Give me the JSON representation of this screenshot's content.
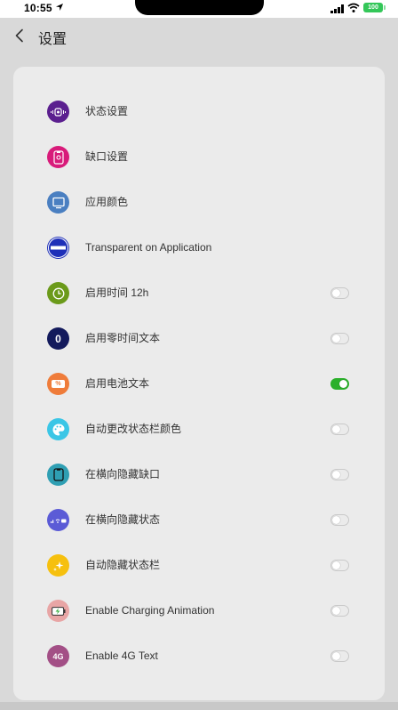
{
  "status_bar": {
    "time": "10:55",
    "battery": "100"
  },
  "header": {
    "title": "设置"
  },
  "colors": {
    "accent_on": "#2bb02b",
    "card_bg": "#ebebeb",
    "page_bg": "#d9d9d9"
  },
  "settings": [
    {
      "label": "状态设置",
      "icon": "status-settings-icon",
      "icon_color": "#5b1f8f",
      "toggle": null
    },
    {
      "label": "缺口设置",
      "icon": "notch-settings-icon",
      "icon_color": "#d81b7a",
      "toggle": null
    },
    {
      "label": "应用颜色",
      "icon": "app-color-icon",
      "icon_color": "#4a7fc1",
      "toggle": null
    },
    {
      "label": "Transparent on Application",
      "icon": "transparent-icon",
      "icon_color": "#1e2fb8",
      "toggle": null
    },
    {
      "label": "启用时间 12h",
      "icon": "clock-icon",
      "icon_color": "#6b9a1a",
      "toggle": false
    },
    {
      "label": "启用零时间文本",
      "icon": "zero-icon",
      "icon_color": "#131a5c",
      "toggle": false
    },
    {
      "label": "启用电池文本",
      "icon": "battery-percent-icon",
      "icon_color": "#ef7c3a",
      "toggle": true
    },
    {
      "label": "自动更改状态栏颜色",
      "icon": "palette-icon",
      "icon_color": "#3bc6e6",
      "toggle": false
    },
    {
      "label": "在横向隐藏缺口",
      "icon": "phone-notch-icon",
      "icon_color": "#2f9fb3",
      "toggle": false
    },
    {
      "label": "在横向隐藏状态",
      "icon": "status-bar-icon",
      "icon_color": "#5b5bd6",
      "toggle": false
    },
    {
      "label": "自动隐藏状态栏",
      "icon": "sparkle-icon",
      "icon_color": "#f6c00e",
      "toggle": false
    },
    {
      "label": "Enable Charging Animation",
      "icon": "charging-icon",
      "icon_color": "#e8a5a5",
      "toggle": false
    },
    {
      "label": "Enable 4G Text",
      "icon": "4g-icon",
      "icon_color": "#a34f86",
      "toggle": false
    }
  ],
  "icon_text": {
    "zero": "0",
    "four_g": "4G",
    "percent": "%"
  }
}
